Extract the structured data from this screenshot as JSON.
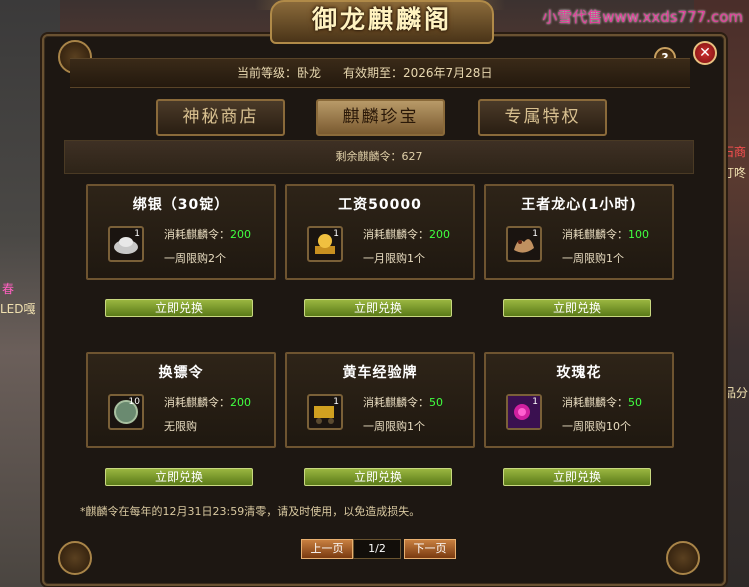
{
  "watermark": "小雪代售www.xxds777.com",
  "title": "御龙麒麟阁",
  "header": {
    "level_label": "当前等级：卧龙",
    "expire_label": "有效期至：2026年7月28日"
  },
  "tabs": [
    {
      "label": "神秘商店",
      "active": false
    },
    {
      "label": "麒麟珍宝",
      "active": true
    },
    {
      "label": "专属特权",
      "active": false
    }
  ],
  "remaining": "剩余麒麟令：627",
  "cost_prefix": "消耗麒麟令：",
  "redeem_label": "立即兑换",
  "items": [
    {
      "name": "绑银（30锭）",
      "count": "1",
      "cost": "200",
      "limit": "一周限购2个",
      "icon": "silver-ingot-icon"
    },
    {
      "name": "工资50000",
      "count": "1",
      "cost": "200",
      "limit": "一月限购1个",
      "icon": "gold-scroll-icon"
    },
    {
      "name": "王者龙心(1小时)",
      "count": "1",
      "cost": "100",
      "limit": "一周限购1个",
      "icon": "dragon-heart-icon"
    },
    {
      "name": "换镖令",
      "count": "10",
      "cost": "200",
      "limit": "无限购",
      "icon": "token-coin-icon"
    },
    {
      "name": "黄车经验牌",
      "count": "1",
      "cost": "50",
      "limit": "一周限购1个",
      "icon": "gold-cart-icon"
    },
    {
      "name": "玫瑰花",
      "count": "1",
      "cost": "50",
      "limit": "一周限购10个",
      "icon": "rose-icon"
    }
  ],
  "note": "*麒麟令在每年的12月31日23:59清零，请及时使用，以免造成损失。",
  "pagination": {
    "prev": "上一页",
    "page": "1/2",
    "next": "下一页"
  },
  "side_texts": {
    "left1": "春",
    "left2": "LED嘎",
    "right1": "石商",
    "right2": "叮咚",
    "right3": "品分"
  }
}
